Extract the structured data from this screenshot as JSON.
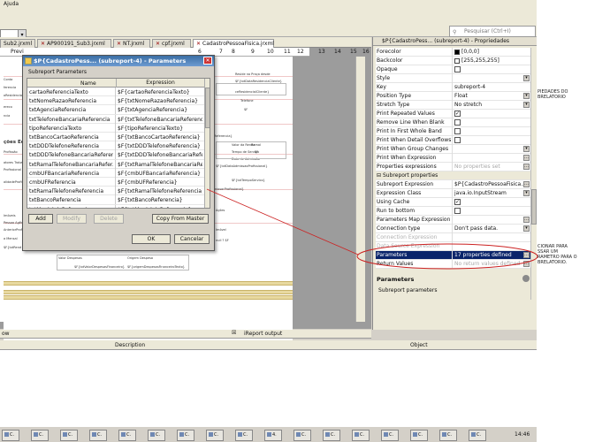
{
  "menubar": {
    "help_label": "Ajuda"
  },
  "toolbar": {
    "search_placeholder": "Pesquisar (Ctrl+I)"
  },
  "editor_tabs": [
    {
      "label": "Sub2.jrxml"
    },
    {
      "label": "AP900191_Sub3.jrxml"
    },
    {
      "label": "NT.jrxml"
    },
    {
      "label": "cpf.jrxml"
    },
    {
      "label": "CadastroPessoaFisica.jrxml"
    }
  ],
  "editor": {
    "preview_label": "Previ",
    "ruler_ticks": [
      "6",
      "7",
      "8",
      "9",
      "10",
      "11",
      "12",
      "13",
      "14",
      "15",
      "16"
    ],
    "left_fragments": [
      "Conta",
      "ferencia",
      "oResidencialCl",
      "ereco",
      "ncia",
      "ções Econ",
      "Profissão",
      "atores Trabalho",
      "Profissional",
      "alidadeProfissi",
      "Imóveis",
      "Pessoa Agência",
      "AnteriorProfissi",
      "a Mensal",
      "$F{txtRend"
    ],
    "right_fragments": [
      "Reside na Praça desde",
      "$F{txtDataResidenciaCliente}",
      "ceResidencialCliente}",
      "Telefone",
      "$F",
      "$F{txtMunicipioReferencia}",
      "Valor da Renda",
      "Tempo de Serviço",
      "Renda Mensal",
      "Data de Admissão",
      "$F{txtDataAdmissaoProfissional}",
      "$F{txtTempoServico}",
      "Ramal",
      "$F",
      "$F{txtOrgaoEmissorProfissional}"
    ],
    "bottom_fragments": [
      "Valor Despesas",
      "Origem Despesa",
      "$F{txtValorDespesasFinanceiro}",
      "$F{origemDespesasFinanceiroTexto}",
      "Imóvel",
      "= null ? $F",
      "Ações"
    ]
  },
  "dialog": {
    "title": "$P{CadastroPess... (subreport-4) - Parameters",
    "section_label": "Subreport Parameters",
    "col_name": "Name",
    "col_expression": "Expression",
    "rows": [
      {
        "name": "cartaoReferenciaTexto",
        "expr": "$F{cartaoReferenciaTexto}"
      },
      {
        "name": "txtNomeRazaoReferencia",
        "expr": "$F{txtNomeRazaoReferencia}"
      },
      {
        "name": "txtAgenciaReferencia",
        "expr": "$F{txtAgenciaReferencia}"
      },
      {
        "name": "txtTelefoneBancariaReferencia",
        "expr": "$F{txtTelefoneBancariaReferencia}"
      },
      {
        "name": "tipoReferenciaTexto",
        "expr": "$F{tipoReferenciaTexto}"
      },
      {
        "name": "txtBancoCartaoReferencia",
        "expr": "$F{txtBancoCartaoReferencia}"
      },
      {
        "name": "txtDDDTelefoneReferencia",
        "expr": "$F{txtDDDTelefoneReferencia}"
      },
      {
        "name": "txtDDDTelefoneBancariaReferencia",
        "expr": "$F{txtDDDTelefoneBancariaRefer..."
      },
      {
        "name": "txtRamalTelefoneBancariaRefer...",
        "expr": "$F{txtRamalTelefoneBancariaRef..."
      },
      {
        "name": "cmbUFBancariaReferencia",
        "expr": "$F{cmbUFBancariaReferencia}"
      },
      {
        "name": "cmbUFReferencia",
        "expr": "$F{cmbUFReferencia}"
      },
      {
        "name": "txtRamalTelefoneReferencia",
        "expr": "$F{txtRamalTelefoneReferencia}"
      },
      {
        "name": "txtBancoReferencia",
        "expr": "$F{txtBancoReferencia}"
      },
      {
        "name": "txtMunicipioReferencia",
        "expr": "$F{txtMunicipioReferencia}"
      }
    ],
    "buttons": {
      "add": "Add",
      "modify": "Modify",
      "delete": "Delete",
      "copy_from_master": "Copy From Master",
      "ok": "OK",
      "cancel": "Cancelar"
    }
  },
  "properties": {
    "title": "$P{CadastroPess... (subreport-4) - Propriedades",
    "rows": [
      {
        "label": "Forecolor",
        "value": "[0,0,0]",
        "swatch": "#000000"
      },
      {
        "label": "Backcolor",
        "value": "[255,255,255]",
        "swatch": "#ffffff"
      },
      {
        "label": "Opaque",
        "check": ""
      },
      {
        "label": "Style",
        "value": "",
        "dropdown": true
      },
      {
        "label": "Key",
        "value": "subreport-4"
      },
      {
        "label": "Position Type",
        "value": "Float",
        "dropdown": true
      },
      {
        "label": "Stretch Type",
        "value": "No stretch",
        "dropdown": true
      },
      {
        "label": "Print Repeated Values",
        "check": "✓"
      },
      {
        "label": "Remove Line When Blank",
        "check": ""
      },
      {
        "label": "Print In First Whole Band",
        "check": ""
      },
      {
        "label": "Print When Detail Overflows",
        "check": ""
      },
      {
        "label": "Print When Group Changes",
        "value": "",
        "dropdown": true
      },
      {
        "label": "Print When Expression",
        "value": "",
        "dots": true
      },
      {
        "label": "Properties expressions",
        "value": "No properties set",
        "dim_value": true,
        "dots": true
      },
      {
        "label": "Subreport properties",
        "category": true
      },
      {
        "label": "Subreport Expression",
        "value": "$P{CadastroPessoaFisica...",
        "dots": true
      },
      {
        "label": "Expression Class",
        "value": "java.io.InputStream",
        "dropdown": true
      },
      {
        "label": "Using Cache",
        "check": "✓"
      },
      {
        "label": "Run to bottom",
        "check": ""
      },
      {
        "label": "Parameters Map Expression",
        "value": "",
        "dots": true
      },
      {
        "label": "Connection type",
        "value": "Don't pass data.",
        "dropdown": true
      },
      {
        "label": "Connection Expression",
        "value": "",
        "disabled": true
      },
      {
        "label": "Data Source Expression",
        "value": "",
        "disabled": true
      },
      {
        "label": "Parameters",
        "value": "17 properties defined",
        "selected": true,
        "dots": true
      },
      {
        "label": "Return Values",
        "value": "No return values defined",
        "dim_value": true,
        "dots": true
      }
    ],
    "desc_title": "Parameters",
    "desc_text": "Subreport parameters"
  },
  "output": {
    "left_label": "ow",
    "right_label": "iReport output",
    "col_description": "Description",
    "col_object": "Object"
  },
  "taskbar": {
    "items": [
      "C.",
      "C.",
      "C.",
      "C.",
      "C.",
      "C.",
      "C.",
      "C.",
      "C.",
      "4.",
      "C.",
      "C.",
      "C.",
      "C.",
      "C.",
      "C.",
      "C."
    ],
    "clock": "14:46"
  },
  "side_notes": {
    "note1": "PIEDADES DO\nBRELATORIO",
    "note2": "CIONAR  PARA\nSSAR UM\nRAMETRO PARA O\nBRELATORIO."
  },
  "colors": {
    "annotation": "#cc2222",
    "selection": "#0a246a",
    "title_bar": "#3a6ea5"
  }
}
